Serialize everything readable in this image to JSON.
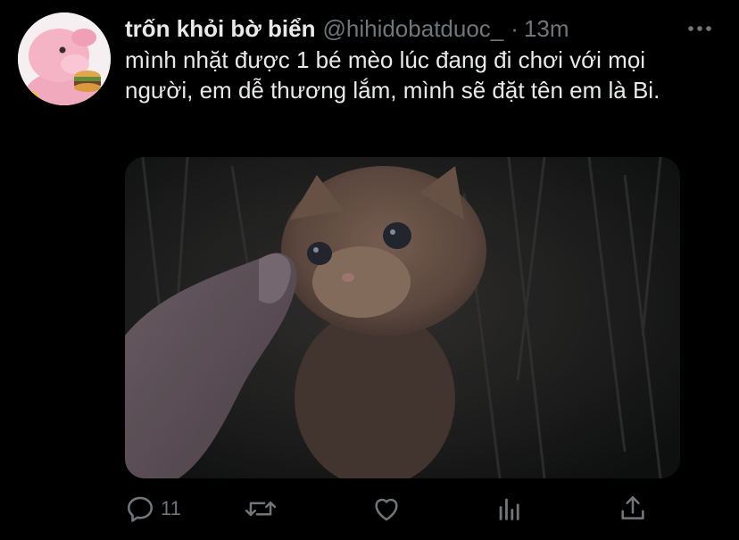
{
  "tweet": {
    "author": {
      "display_name": "trốn khỏi bờ biển",
      "handle": "@hihidobatduoc_",
      "separator": "·",
      "time": "13m"
    },
    "text": "mình nhặt được 1 bé mèo lúc đang đi chơi với mọi người, em dễ thương lắm, mình sẽ đặt tên em là Bi.",
    "media": {
      "description_icon": "photo"
    },
    "actions": {
      "reply_count": "11",
      "retweet_count": "",
      "like_count": ""
    }
  },
  "colors": {
    "background": "#000000",
    "text": "#e7e9ea",
    "secondary": "#71767b",
    "avatar_pink": "#f2a0b8"
  },
  "icons": {
    "more": "more-horizontal-icon",
    "reply": "reply-icon",
    "retweet": "retweet-icon",
    "like": "heart-icon",
    "analytics": "analytics-icon",
    "share": "share-icon"
  }
}
